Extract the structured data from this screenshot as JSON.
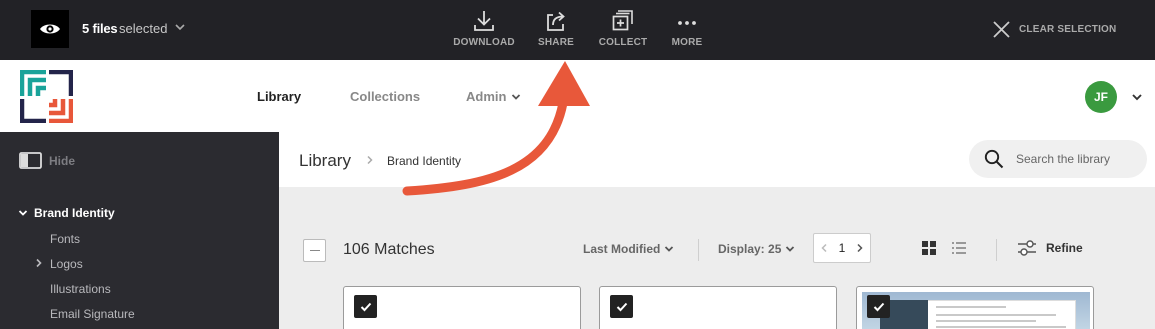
{
  "selection_bar": {
    "count_label": "5 files",
    "selected_label": "selected",
    "actions": {
      "download": "DOWNLOAD",
      "share": "SHARE",
      "collect": "COLLECT",
      "more": "MORE"
    },
    "clear_label": "CLEAR SELECTION"
  },
  "header": {
    "nav": {
      "library": "Library",
      "collections": "Collections",
      "admin": "Admin"
    },
    "avatar_initials": "JF",
    "avatar_color": "#3a9a3f"
  },
  "sidebar": {
    "hide_label": "Hide",
    "tree": {
      "root": "Brand Identity",
      "items": [
        "Fonts",
        "Logos",
        "Illustrations",
        "Email Signature"
      ]
    }
  },
  "breadcrumb": {
    "root": "Library",
    "current": "Brand Identity"
  },
  "search": {
    "placeholder": "Search the library"
  },
  "results": {
    "matches_label": "106 Matches",
    "sort_label": "Last Modified",
    "display_label": "Display: 25",
    "page": "1",
    "refine_label": "Refine",
    "cards": [
      {
        "selected": true
      },
      {
        "selected": true
      },
      {
        "selected": true
      }
    ]
  },
  "colors": {
    "selection_bar_bg": "#222226",
    "sidebar_bg": "#2b2b30",
    "annotation_arrow": "#e8583a",
    "logo_teal": "#1aa39a",
    "logo_navy": "#23244a",
    "logo_orange": "#e8573a"
  }
}
